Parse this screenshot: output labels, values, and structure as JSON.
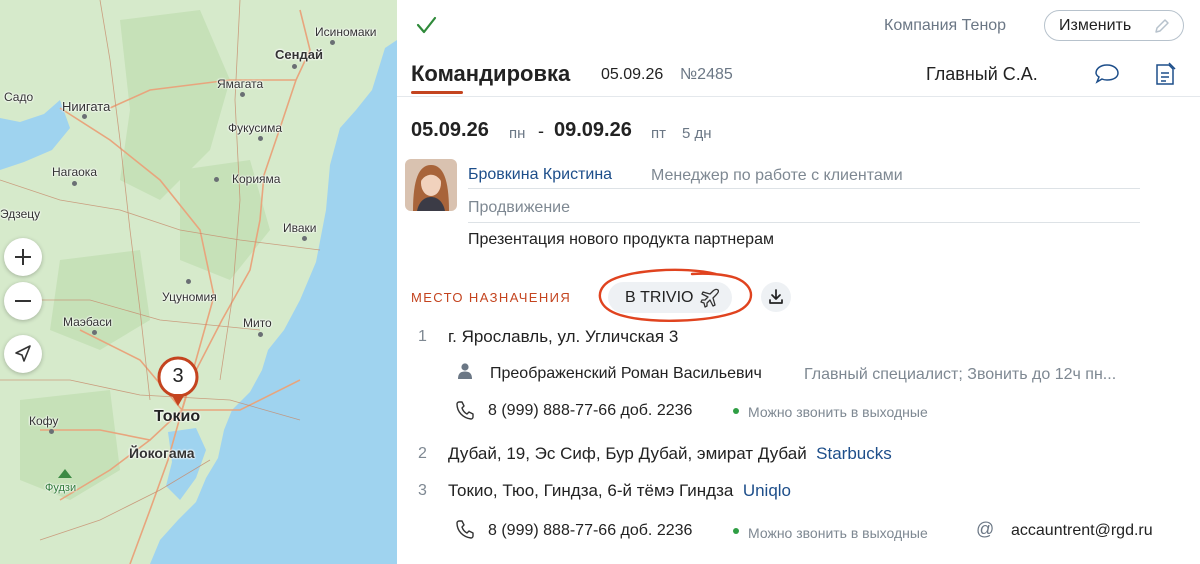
{
  "map": {
    "cities": [
      {
        "key": "isinomaki",
        "label": "Исиномаки"
      },
      {
        "key": "sendai",
        "label": "Сендай"
      },
      {
        "key": "yamagata",
        "label": "Ямагата"
      },
      {
        "key": "sado",
        "label": "Садо"
      },
      {
        "key": "niigata",
        "label": "Ниигата"
      },
      {
        "key": "fukusima",
        "label": "Фукусима"
      },
      {
        "key": "koriyama",
        "label": "Корияма"
      },
      {
        "key": "nagaoka",
        "label": "Нагаока"
      },
      {
        "key": "edzetsu",
        "label": "Эдзецу"
      },
      {
        "key": "iwaki",
        "label": "Иваки"
      },
      {
        "key": "utsunomiya",
        "label": "Уцуномия"
      },
      {
        "key": "maebasi",
        "label": "Маэбаси"
      },
      {
        "key": "mito",
        "label": "Мито"
      },
      {
        "key": "tokyo",
        "label": "Токио"
      },
      {
        "key": "kofu",
        "label": "Кофу"
      },
      {
        "key": "yokohama",
        "label": "Йокогама"
      },
      {
        "key": "fuji",
        "label": "Фудзи"
      }
    ],
    "marker_count": "3",
    "zoom_in_icon": "plus-icon",
    "zoom_out_icon": "minus-icon",
    "locate_icon": "navigation-arrow-icon"
  },
  "header": {
    "status_icon": "checkmark-icon",
    "company": "Компания Тенор",
    "edit_label": "Изменить",
    "title": "Командировка",
    "date": "05.09.26",
    "number": "№2485",
    "responsible": "Главный С.А."
  },
  "trip": {
    "start_date": "05.09.26",
    "start_day": "пн",
    "dash": "-",
    "end_date": "09.09.26",
    "end_day": "пт",
    "duration": "5 дн"
  },
  "employee": {
    "name": "Бровкина Кристина",
    "role": "Менеджер по работе с клиентами",
    "department": "Продвижение",
    "purpose": "Презентация нового продукта партнерам"
  },
  "destinations": {
    "label": "МЕСТО НАЗНАЧЕНИЯ",
    "trivio_label": "В TRIVIO",
    "items": [
      {
        "num": "1",
        "address": "г. Ярославль, ул. Угличская 3",
        "org": "",
        "contact_name": "Преображенский Роман Васильевич",
        "contact_position": "Главный специалист; Звонить до 12ч пн...",
        "phone": "8 (999) 888-77-66 доб. 2236",
        "phone_note": "Можно звонить в выходные"
      },
      {
        "num": "2",
        "address": "Дубай, 19, Эс Сиф, Бур Дубай, эмират Дубай",
        "org": "Starbucks"
      },
      {
        "num": "3",
        "address": "Токио, Тюо, Гиндза, 6-й тёмэ Гиндза",
        "org": "Uniqlo",
        "phone": "8 (999) 888-77-66 доб. 2236",
        "phone_note": "Можно звонить в выходные",
        "email": "accauntrent@rgd.ru"
      }
    ]
  },
  "colors": {
    "accent": "#c4441f",
    "link": "#1d4e8a",
    "muted": "#7e8892",
    "online": "#2f9e44",
    "sea": "#9fd3ef",
    "land": "#d8ebcd"
  }
}
